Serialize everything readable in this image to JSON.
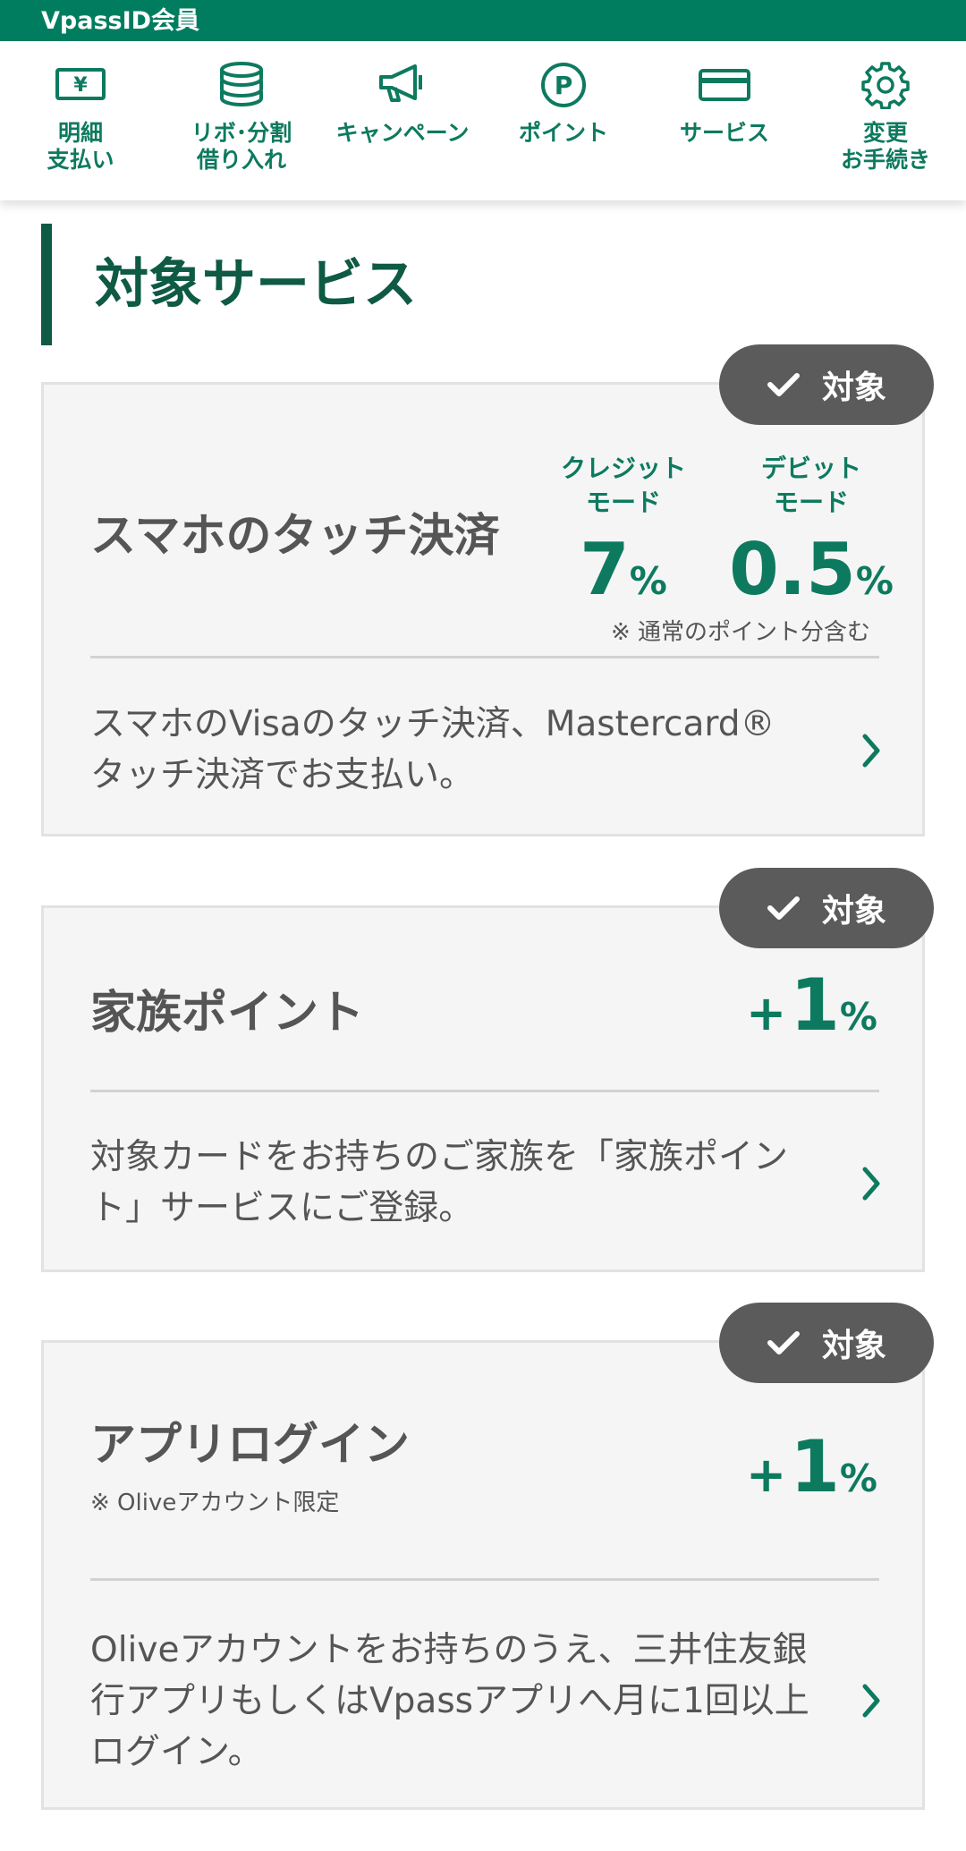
{
  "header": {
    "title": "VpassID会員"
  },
  "nav": {
    "items": [
      {
        "label": "明細\n支払い",
        "icon": "yen-bill-icon"
      },
      {
        "label": "リボ･分割\n借り入れ",
        "icon": "coin-stack-icon"
      },
      {
        "label": "キャンペーン",
        "icon": "megaphone-icon"
      },
      {
        "label": "ポイント",
        "icon": "point-icon"
      },
      {
        "label": "サービス",
        "icon": "card-icon"
      },
      {
        "label": "変更\nお手続き",
        "icon": "gear-icon"
      }
    ]
  },
  "section": {
    "title": "対象サービス"
  },
  "cards": [
    {
      "badge": "対象",
      "name": "スマホのタッチ決済",
      "credit_label": "クレジット\nモード",
      "credit_rate": "7",
      "debit_label": "デビット\nモード",
      "debit_rate": "0.5",
      "percent": "%",
      "note": "※ 通常のポイント分含む",
      "description": "スマホのVisaのタッチ決済、Mastercard®タッチ決済でお支払い。"
    },
    {
      "badge": "対象",
      "name": "家族ポイント",
      "plus": "+",
      "rate": "1",
      "percent": "%",
      "description": "対象カードをお持ちのご家族を「家族ポイント」サービスにご登録。"
    },
    {
      "badge": "対象",
      "name": "アプリログイン",
      "note": "※ Oliveアカウント限定",
      "plus": "+",
      "rate": "1",
      "percent": "%",
      "description": "Oliveアカウントをお持ちのうえ、三井住友銀行アプリもしくはVpassアプリへ月に1回以上ログイン。"
    }
  ],
  "colors": {
    "brand": "#007d5f",
    "accent": "#0d7a5f",
    "badge": "#5b5b5b"
  }
}
